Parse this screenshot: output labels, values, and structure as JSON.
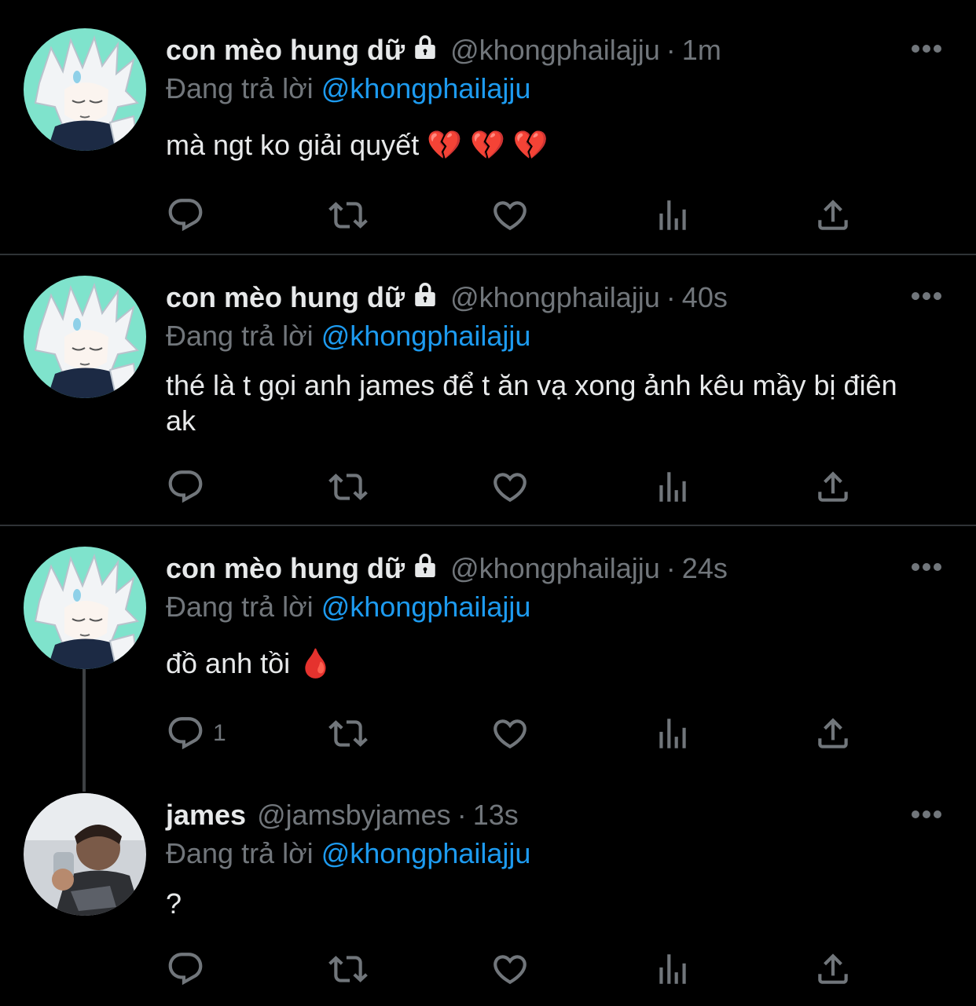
{
  "tweets": [
    {
      "name": "con mèo hung dữ",
      "handle": "@khongphailajju",
      "separator": "·",
      "time": "1m",
      "replying_prefix": "Đang trả lời ",
      "replying_to": "@khongphailajju",
      "text": "mà ngt ko giải quyết 💔 💔 💔",
      "reply_count": "",
      "avatar": "anime-white-hair-avatar",
      "locked": true
    },
    {
      "name": "con mèo hung dữ",
      "handle": "@khongphailajju",
      "separator": "·",
      "time": "40s",
      "replying_prefix": "Đang trả lời ",
      "replying_to": "@khongphailajju",
      "text": "thé là t gọi anh james để t ăn vạ xong ảnh kêu mầy bị điên ak",
      "reply_count": "",
      "avatar": "anime-white-hair-avatar",
      "locked": true
    },
    {
      "name": "con mèo hung dữ",
      "handle": "@khongphailajju",
      "separator": "·",
      "time": "24s",
      "replying_prefix": "Đang trả lời ",
      "replying_to": "@khongphailajju",
      "text": "đồ anh tồi 🩸",
      "reply_count": "1",
      "avatar": "anime-white-hair-avatar",
      "locked": true
    },
    {
      "name": "james",
      "handle": "@jamsbyjames",
      "separator": "·",
      "time": "13s",
      "replying_prefix": "Đang trả lời ",
      "replying_to": "@khongphailajju",
      "text": "?",
      "reply_count": "",
      "avatar": "photo-avatar",
      "locked": false
    }
  ],
  "icons": {
    "reply": "reply-icon",
    "retweet": "retweet-icon",
    "like": "heart-icon",
    "views": "views-icon",
    "share": "share-icon",
    "more": "more-icon",
    "lock": "lock-icon"
  },
  "colors": {
    "background": "#000000",
    "text": "#e7e9ea",
    "muted": "#71767b",
    "link": "#1d9bf0",
    "divider": "#2f3336",
    "avatar_bg": "#7fe3cc"
  }
}
